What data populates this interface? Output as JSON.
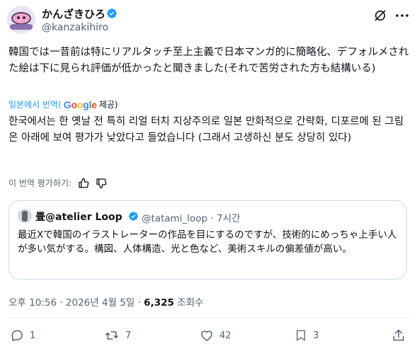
{
  "author": {
    "display_name": "かんざきひろ",
    "handle": "@kanzakihiro"
  },
  "tweet": {
    "original_text": "韓国では一昔前は特にリアルタッチ至上主義で日本マンガ的に簡略化、デフォルメされた絵は下に見られ評価が低かったと聞きました(それで苦労された方も結構いる)",
    "translated_by_prefix": "일본에서 번역(",
    "translated_by_brand": "Google",
    "translated_by_suffix": "제공)",
    "translated_text": "한국에서는 한 옛날 전 특히 리얼 터치 지상주의로 일본 만화적으로 간략화, 디포르메 된 그림은 아래에 보여 평가가 낮았다고 들었습니다 (그래서 고생하신 분도 상당히 있다)",
    "rate_translation_label": "이 번역 평가하기:"
  },
  "quote": {
    "display_name": "畳@atelier Loop",
    "handle": "@tatami_loop",
    "time": "· 7시간",
    "text": "最近Xで韓国のイラストレーターの作品を目にするのですが、技術的にめっちゃ上手い人が多い気がする。構図、人体構造、光と色など、美術スキルの偏差値が高い。"
  },
  "meta": {
    "timestamp": "오후 10:56 · 2026년 4월 5일 · ",
    "views_count": "6,325",
    "views_label": " 조회수"
  },
  "actions": {
    "reply_count": "1",
    "repost_count": "7",
    "like_count": "42",
    "bookmark_count": "3"
  },
  "colors": {
    "accent": "#1d9bf0",
    "text": "#0f1419",
    "secondary": "#536471",
    "border": "#cfd9de"
  }
}
